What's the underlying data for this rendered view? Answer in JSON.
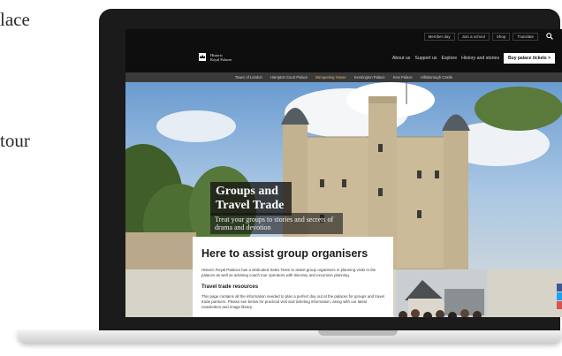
{
  "side_text": [
    "lace",
    "tour"
  ],
  "site": {
    "utility_links": [
      "Member day",
      "Join a school",
      "Shop",
      "Translate"
    ],
    "brand": {
      "line1": "Historic",
      "line2": "Royal Palaces"
    },
    "nav": [
      "About us",
      "Support us",
      "Explore",
      "History and stories"
    ],
    "cta": "Buy palace tickets >",
    "palaces": [
      {
        "label": "Tower of London",
        "active": false
      },
      {
        "label": "Hampton Court Palace",
        "active": false
      },
      {
        "label": "Banqueting House",
        "active": true
      },
      {
        "label": "Kensington Palace",
        "active": false
      },
      {
        "label": "Kew Palace",
        "active": false
      },
      {
        "label": "Hillsborough Castle",
        "active": false
      }
    ]
  },
  "hero": {
    "title": "Groups and Travel Trade",
    "subtitle": "Treat your groups to stories and secrets of drama and devotion"
  },
  "content": {
    "heading": "Here to assist group organisers",
    "para1": "Historic Royal Palaces has a dedicated Sales Team to assist group organisers in planning visits to the palaces as well as advising coach tour operators with itinerary and excursion planning.",
    "subheading": "Travel trade resources",
    "para2": "This page contains all the information needed to plan a perfect day out at the palaces for groups and travel trade partners. Please see below for practical visit and ticketing information, along with our latest newsletters and image library."
  },
  "colors": {
    "share_facebook": "#3b5998",
    "share_twitter": "#1da1f2",
    "share_other": "#d9534f",
    "active_palace": "#e3b96a"
  }
}
